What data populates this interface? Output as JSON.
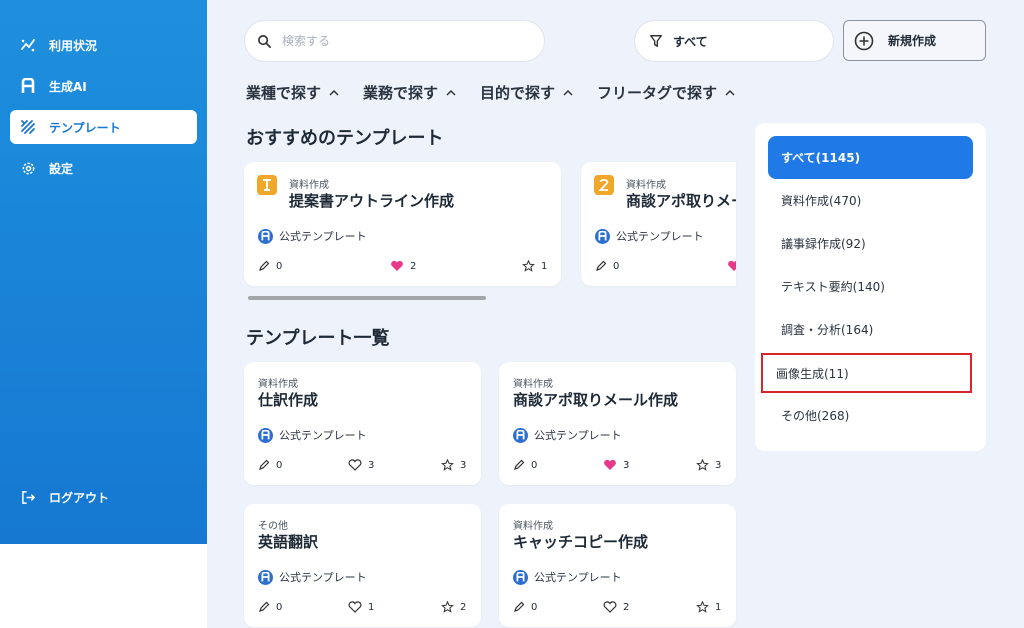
{
  "sidebar": {
    "items": [
      {
        "label": "利用状況",
        "icon": "chart-icon"
      },
      {
        "label": "生成AI",
        "icon": "ai-logo-icon"
      },
      {
        "label": "テンプレート",
        "icon": "template-icon"
      },
      {
        "label": "設定",
        "icon": "gear-icon"
      }
    ],
    "logout_label": "ログアウト"
  },
  "search": {
    "placeholder": "検索する"
  },
  "filter": {
    "label": "すべて"
  },
  "new_button": {
    "label": "新規作成"
  },
  "category_nav": [
    "業種で探す",
    "業務で探す",
    "目的で探す",
    "フリータグで探す"
  ],
  "recommended": {
    "title": "おすすめのテンプレート",
    "cards": [
      {
        "badge": "1",
        "category": "資料作成",
        "title": "提案書アウトライン作成",
        "official": "公式テンプレート",
        "edits": "0",
        "likes": "2",
        "stars": "1",
        "liked": true
      },
      {
        "badge": "2",
        "category": "資料作成",
        "title": "商談アポ取りメール作成",
        "official": "公式テンプレート",
        "edits": "0",
        "likes": "",
        "stars": "",
        "liked": true
      }
    ]
  },
  "list": {
    "title": "テンプレート一覧",
    "cards": [
      {
        "category": "資料作成",
        "title": "仕訳作成",
        "official": "公式テンプレート",
        "edits": "0",
        "likes": "3",
        "stars": "3",
        "liked": false
      },
      {
        "category": "資料作成",
        "title": "商談アポ取りメール作成",
        "official": "公式テンプレート",
        "edits": "0",
        "likes": "3",
        "stars": "3",
        "liked": true
      },
      {
        "category": "その他",
        "title": "英語翻訳",
        "official": "公式テンプレート",
        "edits": "0",
        "likes": "1",
        "stars": "2",
        "liked": false
      },
      {
        "category": "資料作成",
        "title": "キャッチコピー作成",
        "official": "公式テンプレート",
        "edits": "0",
        "likes": "2",
        "stars": "1",
        "liked": false
      }
    ]
  },
  "category_panel": {
    "items": [
      "すべて(1145)",
      "資料作成(470)",
      "議事録作成(92)",
      "テキスト要約(140)",
      "調査・分析(164)",
      "画像生成(11)",
      "その他(268)"
    ]
  },
  "colors": {
    "accent": "#1f7ae8",
    "highlight": "#d6262b",
    "like": "#e8388a",
    "badge": "#f0a72a"
  }
}
